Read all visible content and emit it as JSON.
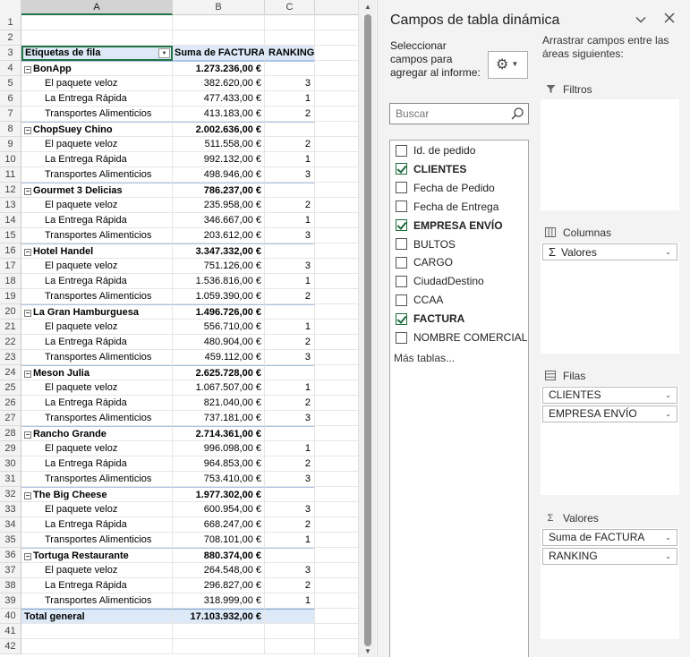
{
  "sheet": {
    "col_headers": [
      "A",
      "B",
      "C"
    ],
    "header": {
      "label": "Etiquetas de fila",
      "sum": "Suma de FACTURA",
      "rank": "RANKING"
    },
    "groups": [
      {
        "name": "BonApp",
        "total": "1.273.236,00 €",
        "rows": [
          {
            "label": "El paquete veloz",
            "value": "382.620,00 €",
            "rank": "3"
          },
          {
            "label": "La Entrega Rápida",
            "value": "477.433,00 €",
            "rank": "1"
          },
          {
            "label": "Transportes Alimenticios",
            "value": "413.183,00 €",
            "rank": "2"
          }
        ]
      },
      {
        "name": "ChopSuey Chino",
        "total": "2.002.636,00 €",
        "rows": [
          {
            "label": "El paquete veloz",
            "value": "511.558,00 €",
            "rank": "2"
          },
          {
            "label": "La Entrega Rápida",
            "value": "992.132,00 €",
            "rank": "1"
          },
          {
            "label": "Transportes Alimenticios",
            "value": "498.946,00 €",
            "rank": "3"
          }
        ]
      },
      {
        "name": "Gourmet 3 Delicias",
        "total": "786.237,00 €",
        "rows": [
          {
            "label": "El paquete veloz",
            "value": "235.958,00 €",
            "rank": "2"
          },
          {
            "label": "La Entrega Rápida",
            "value": "346.667,00 €",
            "rank": "1"
          },
          {
            "label": "Transportes Alimenticios",
            "value": "203.612,00 €",
            "rank": "3"
          }
        ]
      },
      {
        "name": "Hotel Handel",
        "total": "3.347.332,00 €",
        "rows": [
          {
            "label": "El paquete veloz",
            "value": "751.126,00 €",
            "rank": "3"
          },
          {
            "label": "La Entrega Rápida",
            "value": "1.536.816,00 €",
            "rank": "1"
          },
          {
            "label": "Transportes Alimenticios",
            "value": "1.059.390,00 €",
            "rank": "2"
          }
        ]
      },
      {
        "name": "La Gran Hamburguesa",
        "total": "1.496.726,00 €",
        "rows": [
          {
            "label": "El paquete veloz",
            "value": "556.710,00 €",
            "rank": "1"
          },
          {
            "label": "La Entrega Rápida",
            "value": "480.904,00 €",
            "rank": "2"
          },
          {
            "label": "Transportes Alimenticios",
            "value": "459.112,00 €",
            "rank": "3"
          }
        ]
      },
      {
        "name": "Meson Julia",
        "total": "2.625.728,00 €",
        "rows": [
          {
            "label": "El paquete veloz",
            "value": "1.067.507,00 €",
            "rank": "1"
          },
          {
            "label": "La Entrega Rápida",
            "value": "821.040,00 €",
            "rank": "2"
          },
          {
            "label": "Transportes Alimenticios",
            "value": "737.181,00 €",
            "rank": "3"
          }
        ]
      },
      {
        "name": "Rancho Grande",
        "total": "2.714.361,00 €",
        "rows": [
          {
            "label": "El paquete veloz",
            "value": "996.098,00 €",
            "rank": "1"
          },
          {
            "label": "La Entrega Rápida",
            "value": "964.853,00 €",
            "rank": "2"
          },
          {
            "label": "Transportes Alimenticios",
            "value": "753.410,00 €",
            "rank": "3"
          }
        ]
      },
      {
        "name": "The Big Cheese",
        "total": "1.977.302,00 €",
        "rows": [
          {
            "label": "El paquete veloz",
            "value": "600.954,00 €",
            "rank": "3"
          },
          {
            "label": "La Entrega Rápida",
            "value": "668.247,00 €",
            "rank": "2"
          },
          {
            "label": "Transportes Alimenticios",
            "value": "708.101,00 €",
            "rank": "1"
          }
        ]
      },
      {
        "name": "Tortuga Restaurante",
        "total": "880.374,00 €",
        "rows": [
          {
            "label": "El paquete veloz",
            "value": "264.548,00 €",
            "rank": "3"
          },
          {
            "label": "La Entrega Rápida",
            "value": "296.827,00 €",
            "rank": "2"
          },
          {
            "label": "Transportes Alimenticios",
            "value": "318.999,00 €",
            "rank": "1"
          }
        ]
      }
    ],
    "grand_total": {
      "label": "Total general",
      "value": "17.103.932,00 €"
    },
    "icons": {
      "collapse": "minus-box-icon",
      "filter": "dropdown-filter-icon"
    }
  },
  "pane": {
    "title": "Campos de tabla dinámica",
    "choose_fields": "Seleccionar campos para agregar al informe:",
    "search_placeholder": "Buscar",
    "fields": [
      {
        "name": "Id. de pedido",
        "checked": false
      },
      {
        "name": "CLIENTES",
        "checked": true
      },
      {
        "name": "Fecha de Pedido",
        "checked": false
      },
      {
        "name": "Fecha de Entrega",
        "checked": false
      },
      {
        "name": "EMPRESA ENVÍO",
        "checked": true
      },
      {
        "name": "BULTOS",
        "checked": false
      },
      {
        "name": "CARGO",
        "checked": false
      },
      {
        "name": "CiudadDestino",
        "checked": false
      },
      {
        "name": "CCAA",
        "checked": false
      },
      {
        "name": "FACTURA",
        "checked": true
      },
      {
        "name": "NOMBRE COMERCIAL",
        "checked": false
      }
    ],
    "more_tables": "Más tablas...",
    "drag_label": "Arrastrar campos entre las áreas siguientes:",
    "areas": {
      "filters": {
        "title": "Filtros",
        "items": []
      },
      "columns": {
        "title": "Columnas",
        "items": [
          "Valores"
        ]
      },
      "rows": {
        "title": "Filas",
        "items": [
          "CLIENTES",
          "EMPRESA ENVÍO"
        ]
      },
      "values": {
        "title": "Valores",
        "items": [
          "Suma de FACTURA",
          "RANKING"
        ]
      }
    },
    "colors": {
      "accent_green": "#217346",
      "pivot_header_fill": "#dde9f6"
    }
  }
}
